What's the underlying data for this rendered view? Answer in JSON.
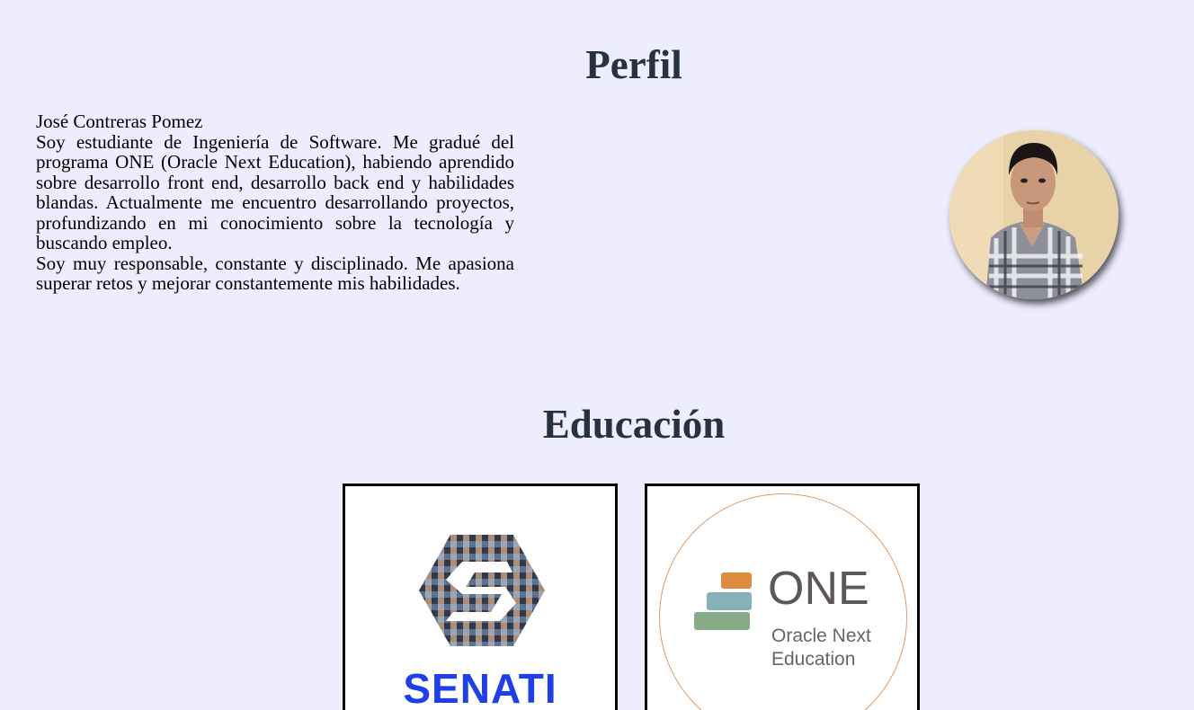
{
  "profile": {
    "title": "Perfil",
    "name": "José Contreras Pomez",
    "paragraph1": "Soy estudiante de Ingeniería de Software. Me gradué del programa ONE (Oracle Next Education), habiendo aprendido sobre desarrollo front end, desarrollo back end y habilidades blandas. Actualmente me encuentro desarrollando proyectos, profundizando en mi conocimiento sobre la tecnología y buscando empleo.",
    "paragraph2": "Soy muy responsable, constante y disciplinado. Me apasiona superar retos y mejorar constantemente mis habilidades."
  },
  "education": {
    "title": "Educación",
    "cards": [
      {
        "logo_text": "SENATI",
        "logo_color": "#1e3ff0"
      },
      {
        "logo_text": "ONE",
        "logo_line1": "Oracle Next",
        "logo_line2": "Education",
        "logo_color": "#5d5755",
        "ring_color": "#e29a62"
      }
    ]
  },
  "colors": {
    "background": "#ededff",
    "heading": "#27313f",
    "card_border": "#000000"
  }
}
